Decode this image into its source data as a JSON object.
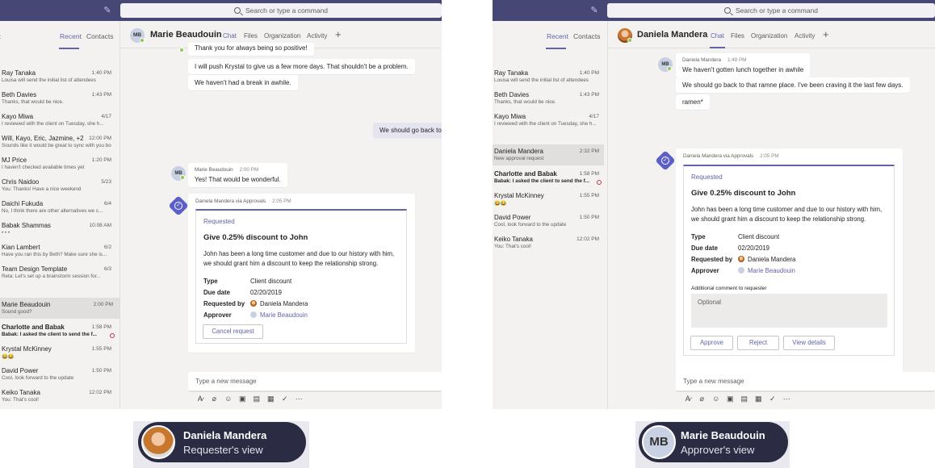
{
  "left": {
    "search_placeholder": "Search or type a command",
    "tabs": {
      "recent": "Recent",
      "contacts": "Contacts"
    },
    "chats": [
      {
        "name": "Ray Tanaka",
        "time": "1:40 PM",
        "preview": "Louisa will send the initial list of attendees"
      },
      {
        "name": "Beth Davies",
        "time": "1:43 PM",
        "preview": "Thanks, that would be nice."
      },
      {
        "name": "Kayo Miwa",
        "time": "4/17",
        "preview": "I reviewed with the client on Tuesday, she h..."
      },
      {
        "name": "Will, Kayo, Eric, Jazmine, +2",
        "time": "12:00 PM",
        "preview": "Sounds like it would be great to sync with you bo..."
      },
      {
        "name": "MJ Price",
        "time": "1:20 PM",
        "preview": "I haven't checked available times yet"
      },
      {
        "name": "Chris Naidoo",
        "time": "5/23",
        "preview": "You: Thanks! Have a nice weekend"
      },
      {
        "name": "Daichi Fukuda",
        "time": "6/4",
        "preview": "No, I think there are other alternatives we c..."
      },
      {
        "name": "Babak Shammas",
        "time": "10:08 AM",
        "preview": "• • •"
      },
      {
        "name": "Kian Lambert",
        "time": "6/2",
        "preview": "Have you ran this by Beth? Make sure she is..."
      },
      {
        "name": "Team Design Template",
        "time": "6/3",
        "preview": "Reta: Let's set up a brainstorm session for..."
      },
      {
        "name": "Marie Beaudouin",
        "time": "2:00 PM",
        "preview": "Sound good?"
      },
      {
        "name": "Charlotte and Babak",
        "time": "1:58 PM",
        "preview": "Babak: I asked the client to send the f..."
      },
      {
        "name": "Krystal McKinney",
        "time": "1:55 PM",
        "preview": "😂😂"
      },
      {
        "name": "David Power",
        "time": "1:50 PM",
        "preview": "Cool, look forward to the update"
      },
      {
        "name": "Keiko Tanaka",
        "time": "12:02 PM",
        "preview": "You: That's cool!"
      }
    ],
    "header": {
      "initials": "MB",
      "name": "Marie Beaudouin",
      "tabs": [
        "Chat",
        "Files",
        "Organization",
        "Activity"
      ]
    },
    "messages": {
      "m1": "Thank you for always being so positive!",
      "m2": "I will push Krystal to give us a few more days. That shouldn't be a problem.",
      "m3": "We haven't had a break in awhile.",
      "mine": "We should go back to",
      "reply_author": "Marie Beaudouin",
      "reply_time": "2:00 PM",
      "reply_text": "Yes! That would be wonderful.",
      "reply_initials": "MB"
    },
    "card": {
      "sender": "Daniela Mandera via Approvals",
      "time": "2:05 PM",
      "status": "Requested",
      "title": "Give 0.25% discount to John",
      "description": "John has been a long time customer and due to our history with him, we should grant him a discount to keep the relationship strong.",
      "type_label": "Type",
      "type_value": "Client discount",
      "due_label": "Due date",
      "due_value": "02/20/2019",
      "requested_label": "Requested by",
      "requested_value": "Daniela Mandera",
      "approver_label": "Approver",
      "approver_value": "Marie Beaudouin",
      "cancel": "Cancel request"
    },
    "composer": "Type a new message",
    "caption": {
      "name": "Daniela Mandera",
      "role": "Requester's view"
    }
  },
  "right": {
    "search_placeholder": "Search or type a command",
    "tabs": {
      "recent": "Recent",
      "contacts": "Contacts"
    },
    "chats": [
      {
        "name": "Ray Tanaka",
        "time": "1:40 PM",
        "preview": "Louisa will send the initial list of attendees"
      },
      {
        "name": "Beth Davies",
        "time": "1:43 PM",
        "preview": "Thanks, that would be nice."
      },
      {
        "name": "Kayo Miwa",
        "time": "4/17",
        "preview": "I reviewed with the client on Tuesday, she h..."
      },
      {
        "name": "Daniela Mandera",
        "time": "2:32 PM",
        "preview": "New approval request"
      },
      {
        "name": "Charlotte and Babak",
        "time": "1:58 PM",
        "preview": "Babak: I asked the client to send the f..."
      },
      {
        "name": "Krystal McKinney",
        "time": "1:55 PM",
        "preview": "😂😂"
      },
      {
        "name": "David Power",
        "time": "1:50 PM",
        "preview": "Cool, look forward to the update"
      },
      {
        "name": "Keiko Tanaka",
        "time": "12:02 PM",
        "preview": "You: That's cool!"
      }
    ],
    "header": {
      "name": "Daniela Mandera",
      "tabs": [
        "Chat",
        "Files",
        "Organization",
        "Activity"
      ]
    },
    "messages": {
      "author": "Daniela Mandera",
      "time": "1:48 PM",
      "m1": "We haven't gotten lunch together in awhile",
      "m2": "We should go back to that ramne place. I've been craving it the last few days.",
      "m3": "ramen*",
      "initials": "MB"
    },
    "card": {
      "sender": "Daniela Mandera via Approvals",
      "time": "2:05 PM",
      "status": "Requested",
      "title": "Give 0.25% discount to John",
      "description": "John has been a long time customer and due to our history with him, we should grant him a discount to keep the relationship strong.",
      "type_label": "Type",
      "type_value": "Client discount",
      "due_label": "Due date",
      "due_value": "02/20/2019",
      "requested_label": "Requested by",
      "requested_value": "Daniela Mandera",
      "approver_label": "Approver",
      "approver_value": "Marie Beaudouin",
      "comment_label": "Additional comment to requester",
      "comment_placeholder": "Optional",
      "approve": "Approve",
      "reject": "Reject",
      "details": "View details"
    },
    "composer": "Type a new message",
    "caption": {
      "initials": "MB",
      "name": "Marie Beaudouin",
      "role": "Approver's view"
    }
  },
  "toolbar_icons": [
    "format-icon",
    "attach-icon",
    "emoji-icon",
    "gif-icon",
    "sticker-icon",
    "meet-icon",
    "approvals-icon",
    "more-icon"
  ],
  "toolbar_glyphs": [
    "A̷",
    "⌀",
    "☺",
    "▣",
    "▤",
    "▦",
    "✓",
    "⋯"
  ],
  "colors": {
    "brand": "#6264a7",
    "topbar": "#464775",
    "background": "#f3f2f1"
  }
}
